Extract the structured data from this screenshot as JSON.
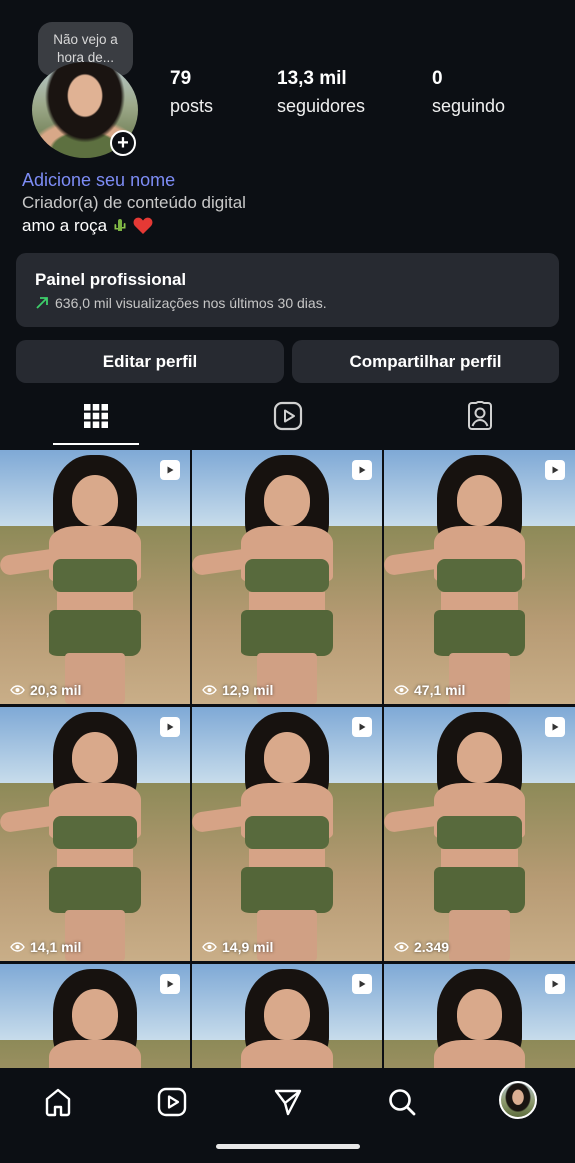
{
  "profile": {
    "note_bubble": [
      "Não vejo a",
      "hora de..."
    ],
    "stats": [
      {
        "value": "79",
        "label": "posts"
      },
      {
        "value": "13,3 mil",
        "label": "seguidores"
      },
      {
        "value": "0",
        "label": "seguindo"
      }
    ],
    "name_prompt": "Adicione seu nome",
    "category": "Criador(a) de conteúdo digital",
    "bio": "amo a roça"
  },
  "professional_panel": {
    "title": "Painel profissional",
    "subtitle": "636,0 mil visualizações nos últimos 30 dias."
  },
  "actions": {
    "edit_profile": "Editar perfil",
    "share_profile": "Compartilhar perfil"
  },
  "tabs": [
    "grid",
    "reels",
    "tagged"
  ],
  "grid_views": [
    "20,3 mil",
    "12,9 mil",
    "47,1 mil",
    "14,1 mil",
    "14,9 mil",
    "2.349"
  ],
  "bottom_nav": [
    "home",
    "reels",
    "messages",
    "search",
    "profile"
  ],
  "colors": {
    "background": "#0c0f14",
    "card": "#272a31",
    "name_link": "#7d8cf5",
    "trend_arrow": "#3ecf6b"
  }
}
